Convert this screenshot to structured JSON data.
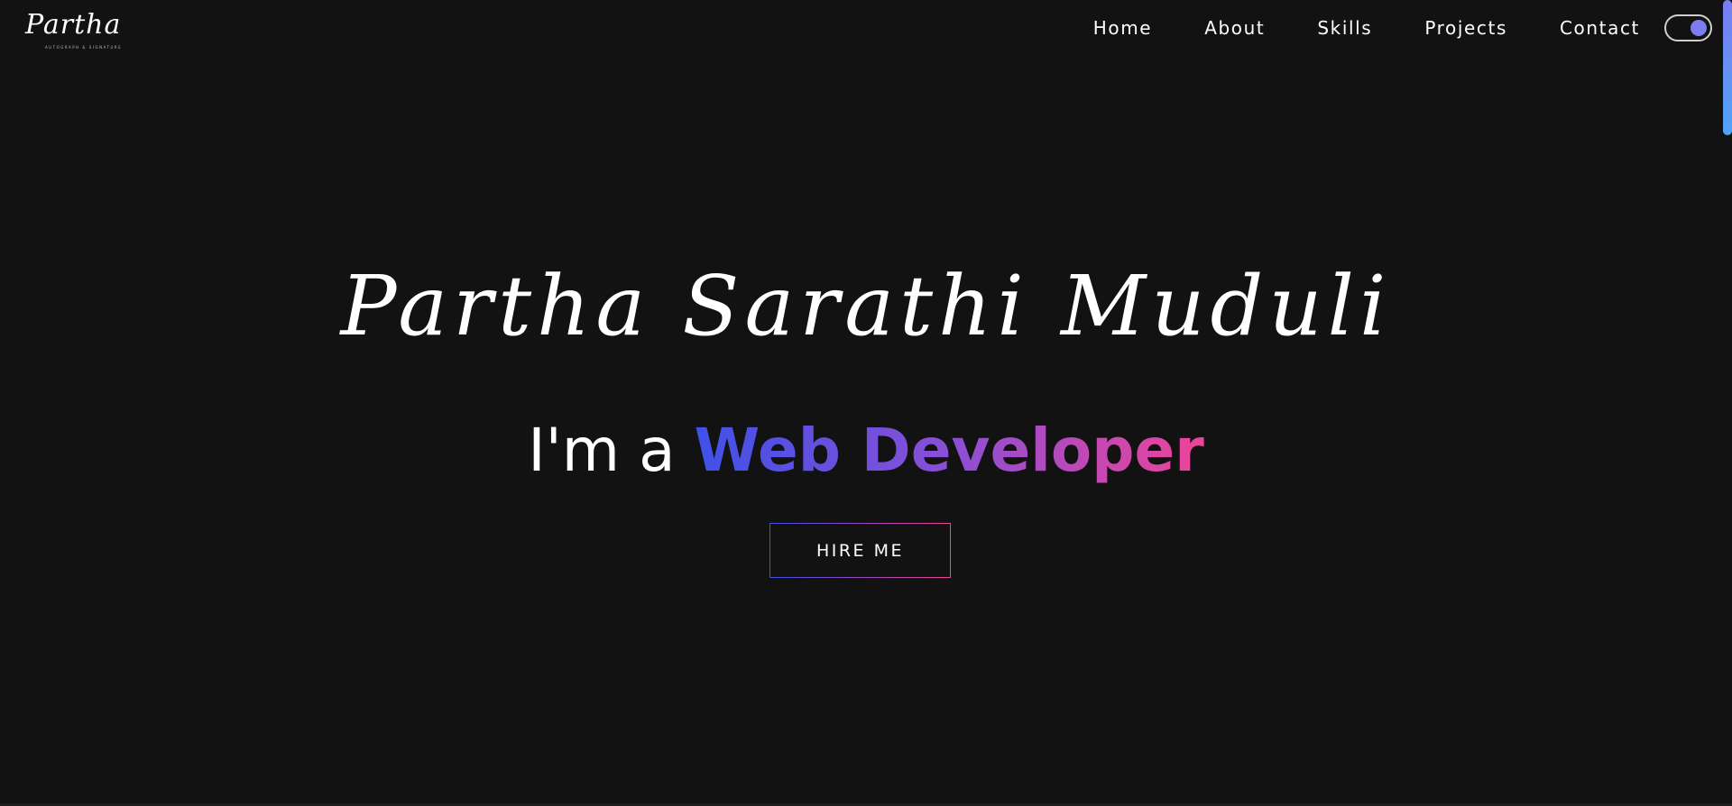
{
  "header": {
    "logo_text": "Partha",
    "logo_subtext": "AUTOGRAPH & SIGNATURE",
    "nav": [
      {
        "label": "Home"
      },
      {
        "label": "About"
      },
      {
        "label": "Skills"
      },
      {
        "label": "Projects"
      },
      {
        "label": "Contact"
      }
    ],
    "theme_toggle": {
      "state": "on",
      "knob_color": "#7b7df0"
    }
  },
  "hero": {
    "name": "Partha Sarathi Muduli",
    "role_prefix": "I'm a ",
    "role_highlight": "Web Developer",
    "cta_label": "HIRE ME"
  },
  "colors": {
    "background": "#121212",
    "gradient_start": "#3f51e8",
    "gradient_mid": "#8a4fd6",
    "gradient_end": "#ee4497",
    "scroll_thumb_top": "#7b7df0",
    "scroll_thumb_bottom": "#4fa3f7"
  }
}
